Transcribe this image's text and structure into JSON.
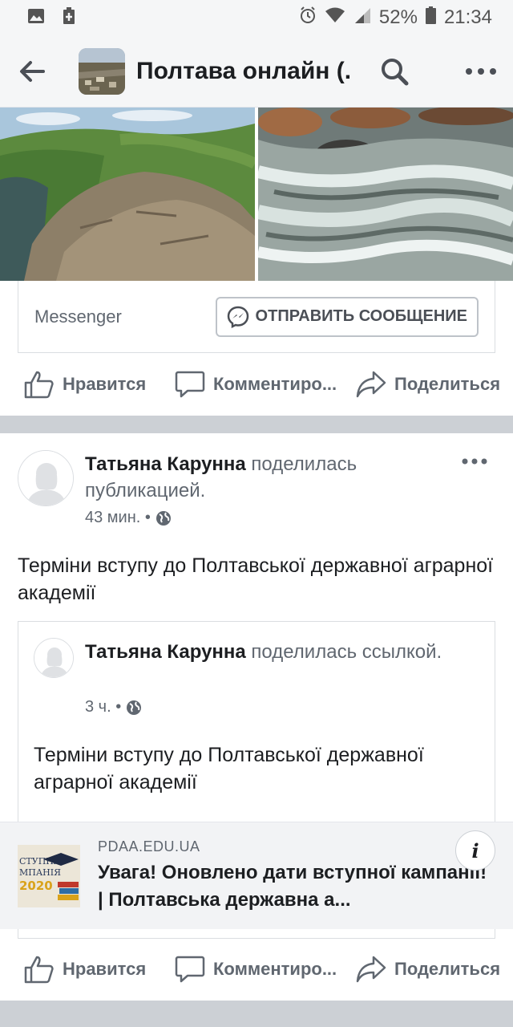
{
  "status_bar": {
    "battery": "52%",
    "time": "21:34"
  },
  "app_bar": {
    "title": "Полтава онлайн (..."
  },
  "messenger_card": {
    "label": "Messenger",
    "send_button": "ОТПРАВИТЬ СООБЩЕНИЕ"
  },
  "actions_top": {
    "like": "Нравится",
    "comment": "Комментиро...",
    "share": "Поделиться"
  },
  "post": {
    "author": "Татьяна Карунна",
    "action": " поделилась публикацией.",
    "time": "43 мин. •",
    "text": "Терміни вступу до Полтавської державної аграрної академії"
  },
  "shared": {
    "author": "Татьяна Карунна",
    "action": " поделилась ссылкой.",
    "time": "3 ч. •",
    "text": "Терміни вступу до Полтавської державної аграрної академії"
  },
  "link": {
    "domain": "PDAA.EDU.UA",
    "title": "Увага! Оновлено дати вступної кампанії! | Полтавська державна а...",
    "thumb_line1": "СТУПНА",
    "thumb_line2": "МПАНІЯ",
    "thumb_year": "2020",
    "info": "i"
  },
  "actions_bottom": {
    "like": "Нравится",
    "comment": "Комментиро...",
    "share": "Поделиться"
  },
  "colors": {
    "bar_bg": "#f5f6f7",
    "text_secondary": "#606770",
    "separator": "#ccd0d5"
  }
}
